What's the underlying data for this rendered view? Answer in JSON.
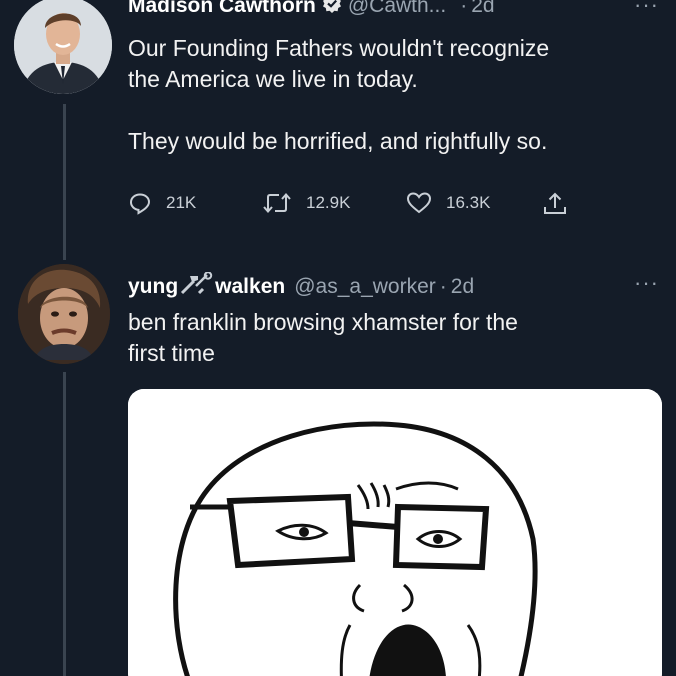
{
  "tweet1": {
    "display_name": "Madison Cawthorn",
    "handle": "@Cawth...",
    "separator": "·",
    "time": "2d",
    "more": "···",
    "text_line1": "Our Founding Fathers wouldn't recognize",
    "text_line2": "the America we live in today.",
    "text_line3": "They would be horrified, and rightfully so.",
    "replies": "21K",
    "retweets": "12.9K",
    "likes": "16.3K"
  },
  "tweet2": {
    "display_name_part1": "yung",
    "display_name_part2": "walken",
    "handle": "@as_a_worker",
    "separator": "·",
    "time": "2d",
    "more": "···",
    "text_line1": "ben franklin browsing xhamster for the",
    "text_line2": "first time"
  },
  "colors": {
    "background": "#141c28",
    "muted": "#9aa5b1",
    "thread_line": "#3a4450"
  }
}
